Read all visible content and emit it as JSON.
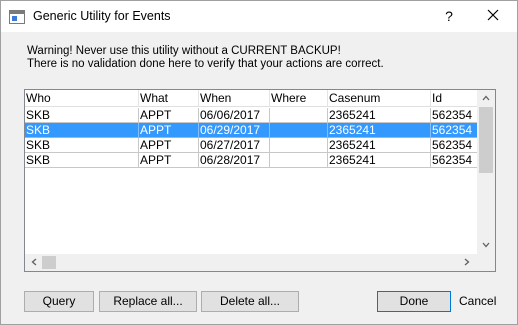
{
  "window": {
    "title": "Generic Utility for Events",
    "help_label": "?",
    "icons": {
      "app": "app-window-icon",
      "close": "close-icon"
    }
  },
  "warning": {
    "line1": "Warning!  Never use this utility without a CURRENT BACKUP!",
    "line2": "There is no validation done here to verify that your actions are correct."
  },
  "grid": {
    "columns": [
      "Who",
      "What",
      "When",
      "Where",
      "Casenum",
      "Id"
    ],
    "rows": [
      {
        "cells": [
          "SKB",
          "APPT",
          "06/06/2017",
          "",
          "2365241",
          "562354"
        ],
        "selected": false
      },
      {
        "cells": [
          "SKB",
          "APPT",
          "06/29/2017",
          "",
          "2365241",
          "562354"
        ],
        "selected": true
      },
      {
        "cells": [
          "SKB",
          "APPT",
          "06/27/2017",
          "",
          "2365241",
          "562354"
        ],
        "selected": false
      },
      {
        "cells": [
          "SKB",
          "APPT",
          "06/28/2017",
          "",
          "2365241",
          "562354"
        ],
        "selected": false
      }
    ],
    "colors": {
      "selection": "#3399ff",
      "gridline": "#c8c8c8"
    }
  },
  "buttons": {
    "query": "Query",
    "replace_all": "Replace all...",
    "delete_all": "Delete all...",
    "done": "Done",
    "cancel": "Cancel"
  }
}
